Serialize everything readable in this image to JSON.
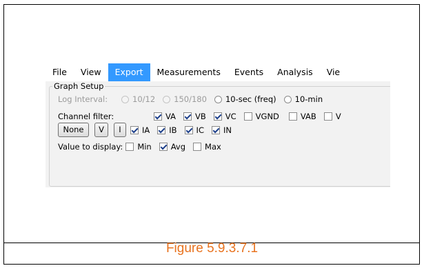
{
  "menu": {
    "items": [
      {
        "label": "File",
        "active": false
      },
      {
        "label": "View",
        "active": false
      },
      {
        "label": "Export",
        "active": true
      },
      {
        "label": "Measurements",
        "active": false
      },
      {
        "label": "Events",
        "active": false
      },
      {
        "label": "Analysis",
        "active": false
      },
      {
        "label": "Vie",
        "active": false
      }
    ],
    "highlight_color": "#3399ff"
  },
  "graph_setup": {
    "title": "Graph Setup",
    "log_interval": {
      "label": "Log Interval:",
      "options": [
        {
          "label": "10/12",
          "enabled": false
        },
        {
          "label": "150/180",
          "enabled": false
        },
        {
          "label": "10-sec (freq)",
          "enabled": true
        },
        {
          "label": "10-min",
          "enabled": true
        }
      ]
    },
    "channel_filter": {
      "label": "Channel filter:",
      "voltage": [
        {
          "label": "VA",
          "checked": true
        },
        {
          "label": "VB",
          "checked": true
        },
        {
          "label": "VC",
          "checked": true
        },
        {
          "label": "VGND",
          "checked": false
        },
        {
          "label": "VAB",
          "checked": false
        },
        {
          "label": "V",
          "checked": false
        }
      ],
      "current": [
        {
          "label": "IA",
          "checked": true
        },
        {
          "label": "IB",
          "checked": true
        },
        {
          "label": "IC",
          "checked": true
        },
        {
          "label": "IN",
          "checked": true
        }
      ],
      "buttons": [
        "None",
        "V",
        "I"
      ]
    },
    "value_to_display": {
      "label": "Value to display:",
      "options": [
        {
          "label": "Min",
          "checked": false
        },
        {
          "label": "Avg",
          "checked": true
        },
        {
          "label": "Max",
          "checked": false
        }
      ]
    }
  },
  "caption": "Figure 5.9.3.7.1",
  "caption_color": "#e8731f"
}
